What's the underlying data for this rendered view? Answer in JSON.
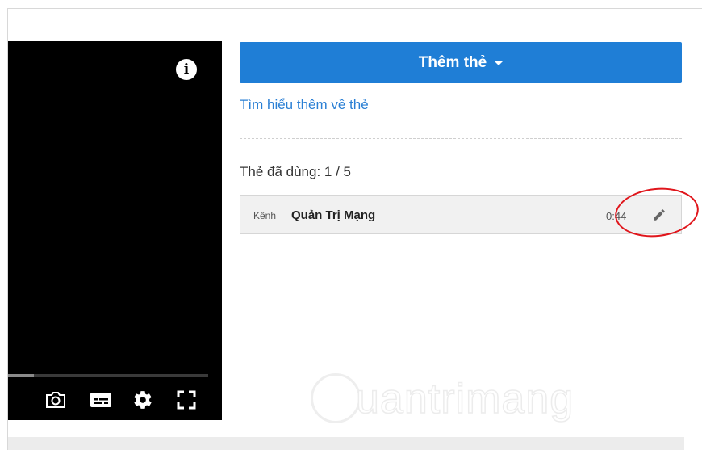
{
  "player": {
    "info_icon": "info-icon",
    "progress": 0.13,
    "controls": [
      {
        "name": "screenshot-button",
        "icon": "camera-icon"
      },
      {
        "name": "subtitles-button",
        "icon": "subtitles-icon"
      },
      {
        "name": "settings-button",
        "icon": "gear-icon"
      },
      {
        "name": "fullscreen-button",
        "icon": "fullscreen-icon"
      }
    ]
  },
  "cards_panel": {
    "add_button_label": "Thêm thẻ",
    "learn_more_link": "Tìm hiểu thêm về thẻ",
    "used_count": "Thẻ đã dùng: 1 / 5",
    "cards": [
      {
        "type": "Kênh",
        "title": "Quản Trị Mạng",
        "time": "0:44"
      }
    ]
  },
  "watermark": {
    "text": "uantrimang"
  },
  "colors": {
    "primary": "#1f7ed6",
    "link": "#2a7fd4",
    "highlight": "#e0161c"
  }
}
